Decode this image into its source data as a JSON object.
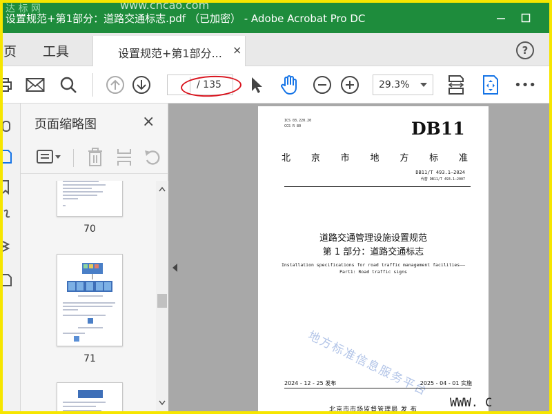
{
  "window": {
    "title": "设置规范+第1部分：道路交通标志.pdf （已加密） - Adobe Acrobat Pro DC",
    "watermark_top": "www.cncao.com",
    "logo_text": "达 标 网"
  },
  "menu": {
    "home": "主页",
    "tools": "工具",
    "doc_tab": "设置规范+第1部分...",
    "doc_tab_close": "×",
    "help": "?"
  },
  "toolbar": {
    "page_current": "",
    "page_total": "/ 135",
    "zoom": "29.3%",
    "more": "•••"
  },
  "panel": {
    "title": "页面缩略图",
    "close": "×",
    "thumbs": [
      {
        "num": "70"
      },
      {
        "num": "71"
      },
      {
        "num": ""
      }
    ]
  },
  "document": {
    "code1": "ICS 03.220.20",
    "code2": "CCS R 80",
    "db": "DB11",
    "city": [
      "北",
      "京",
      "市",
      "地",
      "方",
      "标",
      "准"
    ],
    "std_no": "DB11/T 493.1—2024",
    "replaces": "代替 DB11/T 493.1—2007",
    "title_line1": "道路交通管理设施设置规范",
    "title_line2": "第 1 部分：道路交通标志",
    "en_line1": "Installation specifications for road traffic management facilities——",
    "en_line2": "Part1: Road traffic signs",
    "date_pub": "2024 - 12 - 25 发布",
    "date_impl": "2025 - 04 - 01 实施",
    "publisher": "北京市市场监督管理局    发 布",
    "watermark": "地方标准信息服务平台",
    "www": "WWW. C"
  },
  "colors": {
    "titlebar": "#1e8c3c",
    "frame": "#f6e600",
    "annotation": "#d9141e",
    "accent_blue": "#1473e6"
  }
}
